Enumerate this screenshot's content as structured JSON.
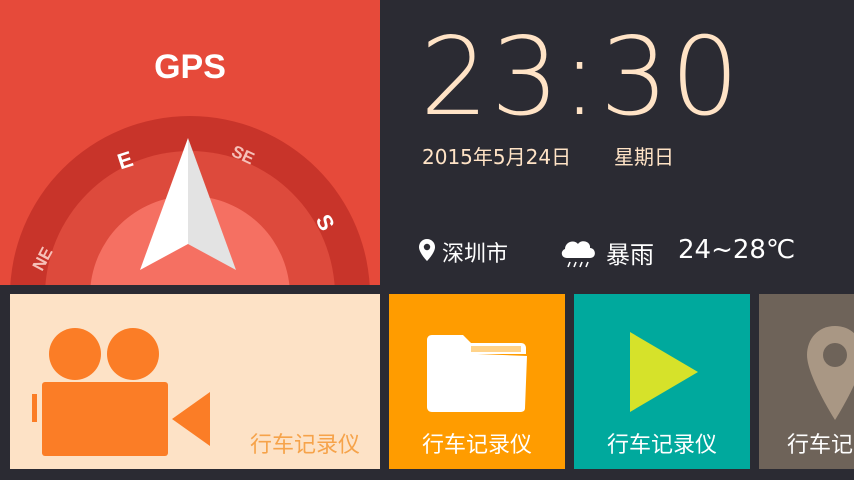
{
  "gps": {
    "title": "GPS",
    "directions": [
      "E",
      "SE",
      "S",
      "NE"
    ]
  },
  "clock": {
    "time": "23:30",
    "date": "2015年5月24日",
    "weekday": "星期日"
  },
  "location": {
    "city": "深圳市",
    "icon": "location-pin-icon"
  },
  "weather": {
    "condition": "暴雨",
    "temperature": "24~28℃",
    "icon": "heavy-rain-cloud-icon"
  },
  "tiles": [
    {
      "label": "行车记录仪",
      "icon": "video-camera-icon",
      "color": "#fde2c6"
    },
    {
      "label": "行车记录仪",
      "icon": "folder-icon",
      "color": "#ff9c00"
    },
    {
      "label": "行车记录仪",
      "icon": "play-icon",
      "color": "#00a99d"
    },
    {
      "label": "行车记录仪",
      "icon": "map-pin-icon",
      "color": "#6e6359"
    }
  ],
  "colors": {
    "gps_red": "#e64a3a",
    "clock_text": "#ffe3c6",
    "background": "#2b2b33"
  }
}
